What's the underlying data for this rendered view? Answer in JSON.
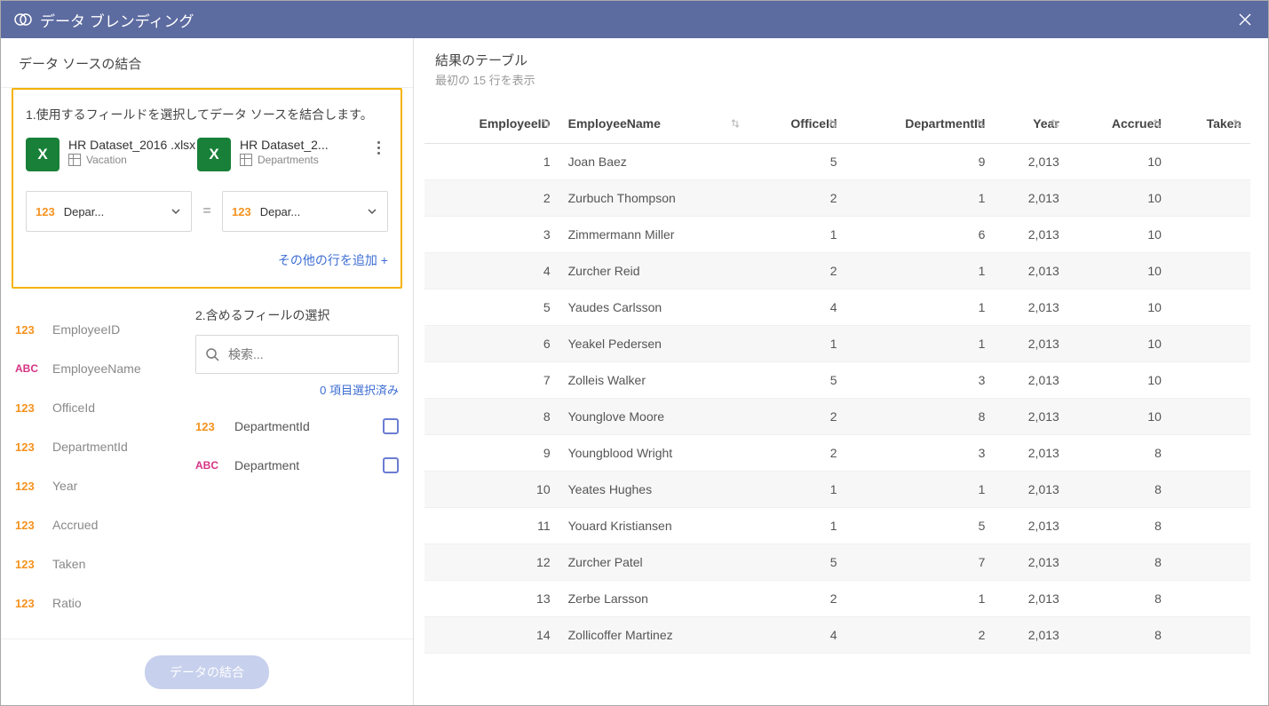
{
  "titlebar": {
    "title": "データ ブレンディング"
  },
  "left": {
    "heading": "データ ソースの結合",
    "step1_title": "1.使用するフィールドを選択してデータ ソースを結合します。",
    "sourceA": {
      "name": "HR Dataset_2016 .xlsx",
      "sheet": "Vacation"
    },
    "sourceB": {
      "name": "HR Dataset_2...",
      "sheet": "Departments"
    },
    "joinA_label": "Depar...",
    "joinB_label": "Depar...",
    "equals": "=",
    "add_row": "その他の行を追加 +",
    "step2_title": "2.含めるフィールの選択",
    "search_placeholder": "検索...",
    "selected_count": "0 項目選択済み",
    "fieldsA": [
      {
        "type": "123",
        "name": "EmployeeID"
      },
      {
        "type": "abc",
        "name": "EmployeeName"
      },
      {
        "type": "123",
        "name": "OfficeId"
      },
      {
        "type": "123",
        "name": "DepartmentId"
      },
      {
        "type": "123",
        "name": "Year"
      },
      {
        "type": "123",
        "name": "Accrued"
      },
      {
        "type": "123",
        "name": "Taken"
      },
      {
        "type": "123",
        "name": "Ratio"
      }
    ],
    "fieldsB": [
      {
        "type": "123",
        "name": "DepartmentId"
      },
      {
        "type": "abc",
        "name": "Department"
      }
    ],
    "combine_button": "データの結合"
  },
  "right": {
    "title": "結果のテーブル",
    "subtitle": "最初の 15 行を表示",
    "columns": [
      "EmployeeID",
      "EmployeeName",
      "OfficeId",
      "DepartmentId",
      "Year",
      "Accrued",
      "Taken"
    ],
    "rows": [
      {
        "EmployeeID": "1",
        "EmployeeName": "Joan Baez",
        "OfficeId": "5",
        "DepartmentId": "9",
        "Year": "2,013",
        "Accrued": "10",
        "Taken": ""
      },
      {
        "EmployeeID": "2",
        "EmployeeName": "Zurbuch Thompson",
        "OfficeId": "2",
        "DepartmentId": "1",
        "Year": "2,013",
        "Accrued": "10",
        "Taken": ""
      },
      {
        "EmployeeID": "3",
        "EmployeeName": "Zimmermann Miller",
        "OfficeId": "1",
        "DepartmentId": "6",
        "Year": "2,013",
        "Accrued": "10",
        "Taken": ""
      },
      {
        "EmployeeID": "4",
        "EmployeeName": "Zurcher Reid",
        "OfficeId": "2",
        "DepartmentId": "1",
        "Year": "2,013",
        "Accrued": "10",
        "Taken": ""
      },
      {
        "EmployeeID": "5",
        "EmployeeName": "Yaudes Carlsson",
        "OfficeId": "4",
        "DepartmentId": "1",
        "Year": "2,013",
        "Accrued": "10",
        "Taken": ""
      },
      {
        "EmployeeID": "6",
        "EmployeeName": "Yeakel Pedersen",
        "OfficeId": "1",
        "DepartmentId": "1",
        "Year": "2,013",
        "Accrued": "10",
        "Taken": ""
      },
      {
        "EmployeeID": "7",
        "EmployeeName": "Zolleis Walker",
        "OfficeId": "5",
        "DepartmentId": "3",
        "Year": "2,013",
        "Accrued": "10",
        "Taken": ""
      },
      {
        "EmployeeID": "8",
        "EmployeeName": "Younglove Moore",
        "OfficeId": "2",
        "DepartmentId": "8",
        "Year": "2,013",
        "Accrued": "10",
        "Taken": ""
      },
      {
        "EmployeeID": "9",
        "EmployeeName": "Youngblood Wright",
        "OfficeId": "2",
        "DepartmentId": "3",
        "Year": "2,013",
        "Accrued": "8",
        "Taken": ""
      },
      {
        "EmployeeID": "10",
        "EmployeeName": "Yeates Hughes",
        "OfficeId": "1",
        "DepartmentId": "1",
        "Year": "2,013",
        "Accrued": "8",
        "Taken": ""
      },
      {
        "EmployeeID": "11",
        "EmployeeName": "Youard Kristiansen",
        "OfficeId": "1",
        "DepartmentId": "5",
        "Year": "2,013",
        "Accrued": "8",
        "Taken": ""
      },
      {
        "EmployeeID": "12",
        "EmployeeName": "Zurcher Patel",
        "OfficeId": "5",
        "DepartmentId": "7",
        "Year": "2,013",
        "Accrued": "8",
        "Taken": ""
      },
      {
        "EmployeeID": "13",
        "EmployeeName": "Zerbe Larsson",
        "OfficeId": "2",
        "DepartmentId": "1",
        "Year": "2,013",
        "Accrued": "8",
        "Taken": ""
      },
      {
        "EmployeeID": "14",
        "EmployeeName": "Zollicoffer Martinez",
        "OfficeId": "4",
        "DepartmentId": "2",
        "Year": "2,013",
        "Accrued": "8",
        "Taken": ""
      }
    ]
  }
}
